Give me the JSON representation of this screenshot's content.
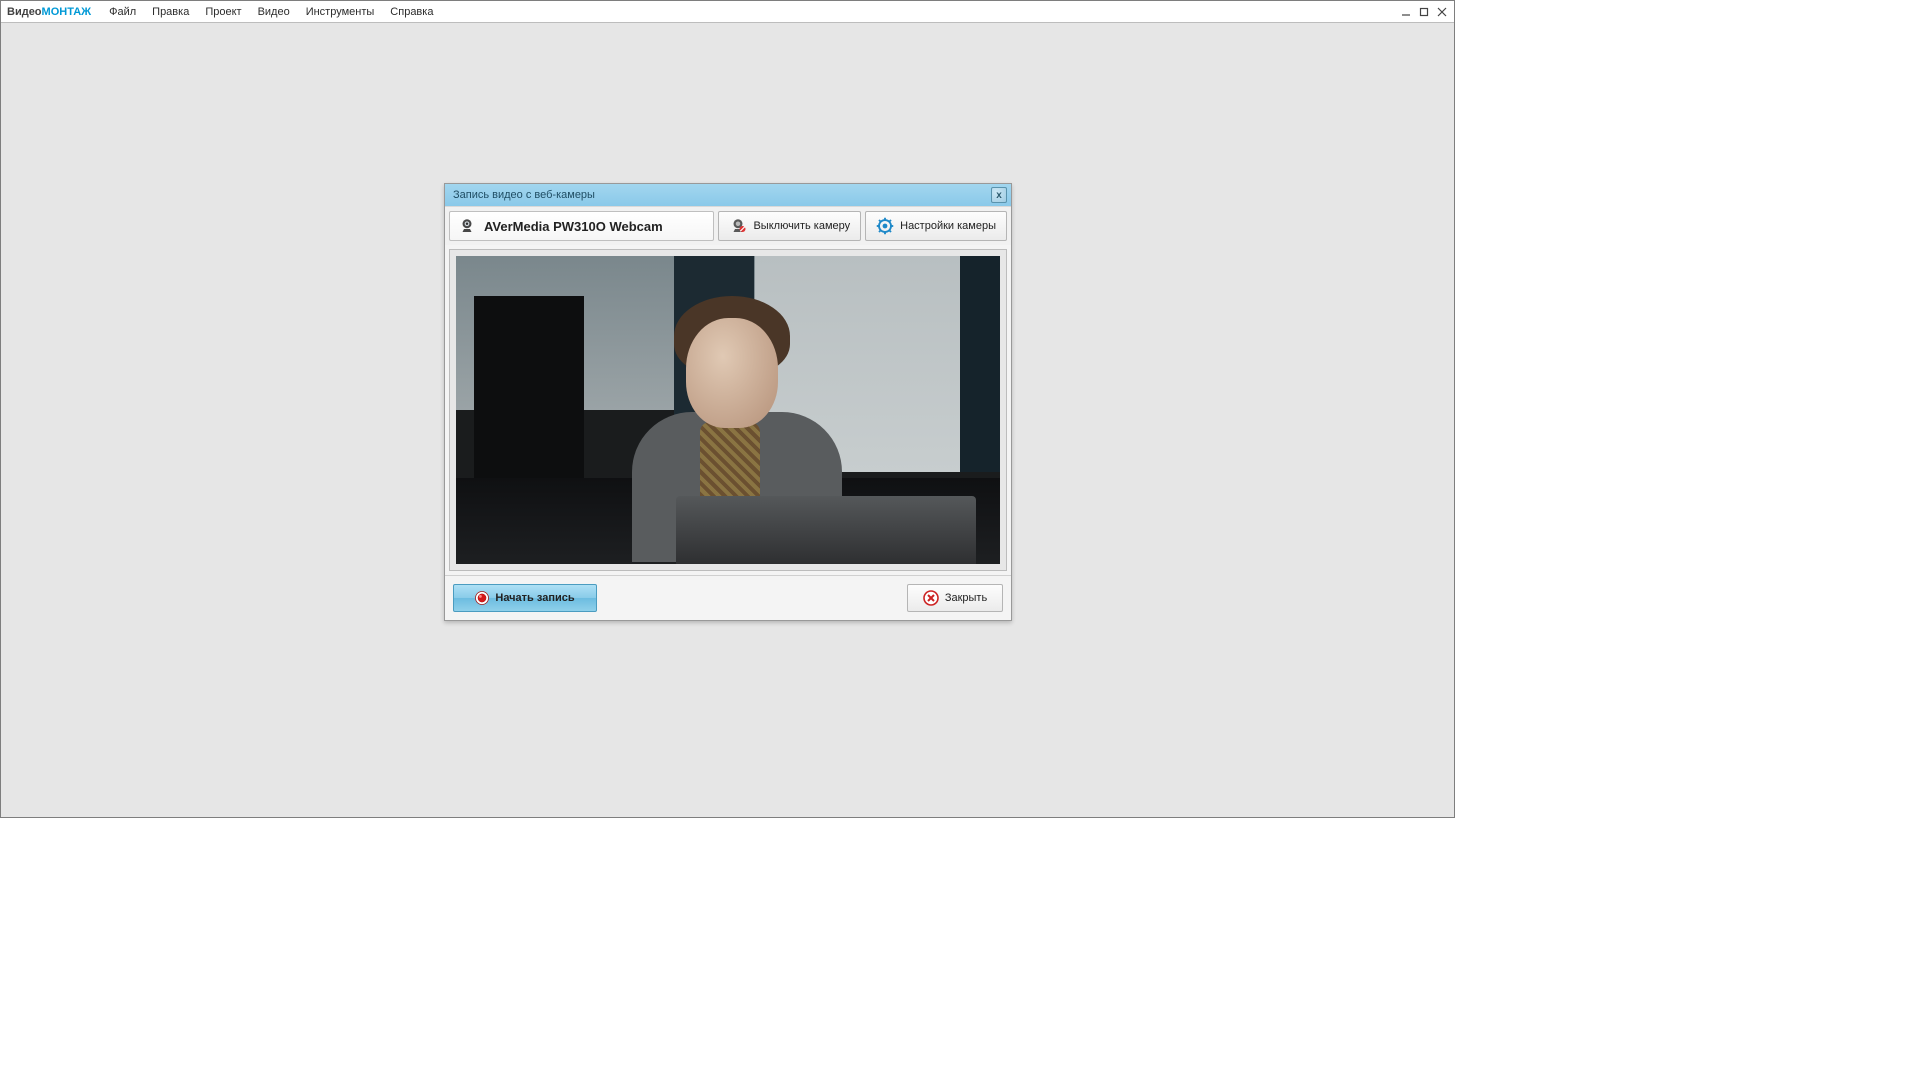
{
  "app": {
    "title_part1": "Видео",
    "title_part2": "МОНТАЖ"
  },
  "menu": {
    "file": "Файл",
    "edit": "Правка",
    "project": "Проект",
    "video": "Видео",
    "tools": "Инструменты",
    "help": "Справка"
  },
  "window_controls": {
    "minimize": "—",
    "maximize": "▢",
    "close": "✕"
  },
  "dialog": {
    "title": "Запись видео с веб-камеры",
    "close_glyph": "x",
    "camera_name": "AVerMedia PW310O Webcam",
    "btn_disable_camera": "Выключить камеру",
    "btn_camera_settings": "Настройки камеры",
    "btn_start_record": "Начать запись",
    "btn_close": "Закрыть"
  }
}
